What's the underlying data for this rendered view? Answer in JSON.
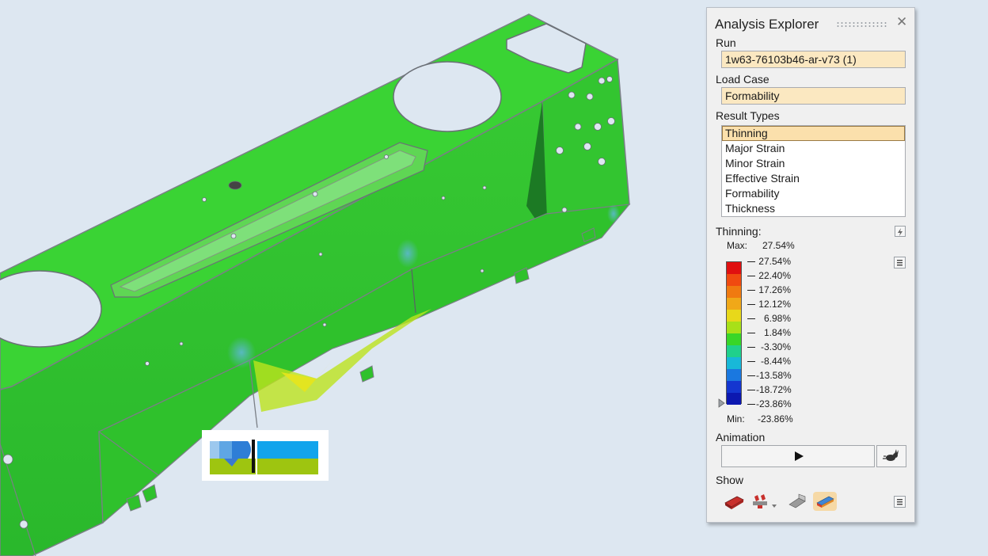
{
  "panel": {
    "title": "Analysis Explorer",
    "run_label": "Run",
    "run_value": "1w63-76103b46-ar-v73 (1)",
    "load_case_label": "Load Case",
    "load_case_value": "Formability",
    "result_types_label": "Result Types",
    "result_types": [
      "Thinning",
      "Major Strain",
      "Minor Strain",
      "Effective Strain",
      "Formability",
      "Thickness"
    ],
    "selected_result_type": "Thinning",
    "legend": {
      "title": "Thinning:",
      "max_label": "Max:",
      "max_value": "27.54%",
      "min_label": "Min:",
      "min_value": "-23.86%",
      "values": [
        "27.54%",
        "22.40%",
        "17.26%",
        "12.12%",
        "6.98%",
        "1.84%",
        "-3.30%",
        "-8.44%",
        "-13.58%",
        "-18.72%",
        "-23.86%"
      ],
      "colors": [
        "#e01010",
        "#f04a10",
        "#f07a10",
        "#f0a818",
        "#e8d81a",
        "#a8e018",
        "#38d628",
        "#20d08c",
        "#18b8d8",
        "#1a78e0",
        "#1436d0",
        "#0c18b0"
      ]
    },
    "animation_label": "Animation",
    "show_label": "Show"
  },
  "icons": {
    "close": "close-icon",
    "lightning": "lightning-icon",
    "menu": "menu-icon",
    "play": "play-icon",
    "rabbit": "rabbit-speed-icon"
  }
}
